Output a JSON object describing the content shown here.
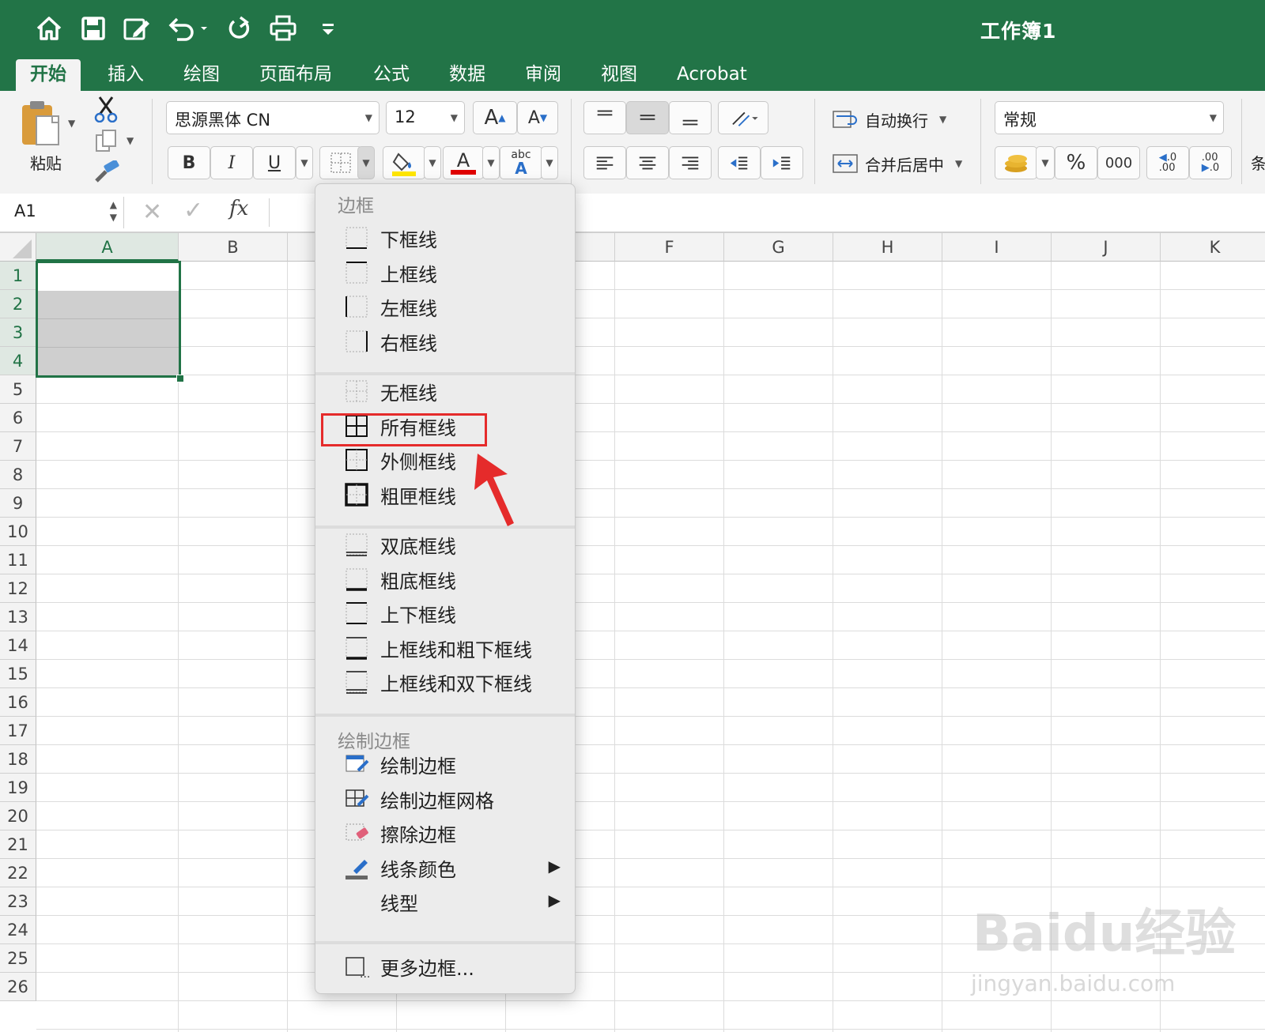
{
  "app": {
    "workbook_title": "工作簿1"
  },
  "tabs": [
    {
      "label": "开始",
      "active": true
    },
    {
      "label": "插入"
    },
    {
      "label": "绘图"
    },
    {
      "label": "页面布局"
    },
    {
      "label": "公式"
    },
    {
      "label": "数据"
    },
    {
      "label": "审阅"
    },
    {
      "label": "视图"
    },
    {
      "label": "Acrobat"
    }
  ],
  "ribbon": {
    "paste_label": "粘贴",
    "font_name": "思源黑体 CN",
    "font_size": "12",
    "grow_font": "A",
    "shrink_font": "A",
    "bold": "B",
    "italic": "I",
    "underline": "U",
    "font_color_letter": "A",
    "abc_label": "abc",
    "wrap_text": "自动换行",
    "merge_center": "合并后居中",
    "number_format": "常规",
    "percent": "%",
    "thousands": "000",
    "cut_label": "条",
    "fill_color": "#ffe600",
    "font_color": "#e00000"
  },
  "formula_bar": {
    "name_box": "A1",
    "fx": "fx"
  },
  "grid": {
    "columns": [
      "A",
      "B",
      "",
      "",
      "",
      "F",
      "G",
      "H",
      "I",
      "J",
      "K"
    ],
    "rows": [
      "1",
      "2",
      "3",
      "4",
      "5",
      "6",
      "7",
      "8",
      "9",
      "10",
      "11",
      "12",
      "13",
      "14",
      "15",
      "16",
      "17",
      "18",
      "19",
      "20",
      "21",
      "22",
      "23",
      "24",
      "25",
      "26"
    ]
  },
  "border_menu": {
    "section1_header": "边框",
    "items1": [
      "下框线",
      "上框线",
      "左框线",
      "右框线"
    ],
    "items2": [
      "无框线",
      "所有框线",
      "外侧框线",
      "粗匣框线"
    ],
    "items3": [
      "双底框线",
      "粗底框线",
      "上下框线",
      "上框线和粗下框线",
      "上框线和双下框线"
    ],
    "section2_header": "绘制边框",
    "items4": [
      "绘制边框",
      "绘制边框网格",
      "擦除边框",
      "线条颜色",
      "线型"
    ],
    "more": "更多边框...",
    "highlighted_item": "所有框线"
  },
  "watermark": {
    "brand": "Baidu经验",
    "url": "jingyan.baidu.com"
  }
}
